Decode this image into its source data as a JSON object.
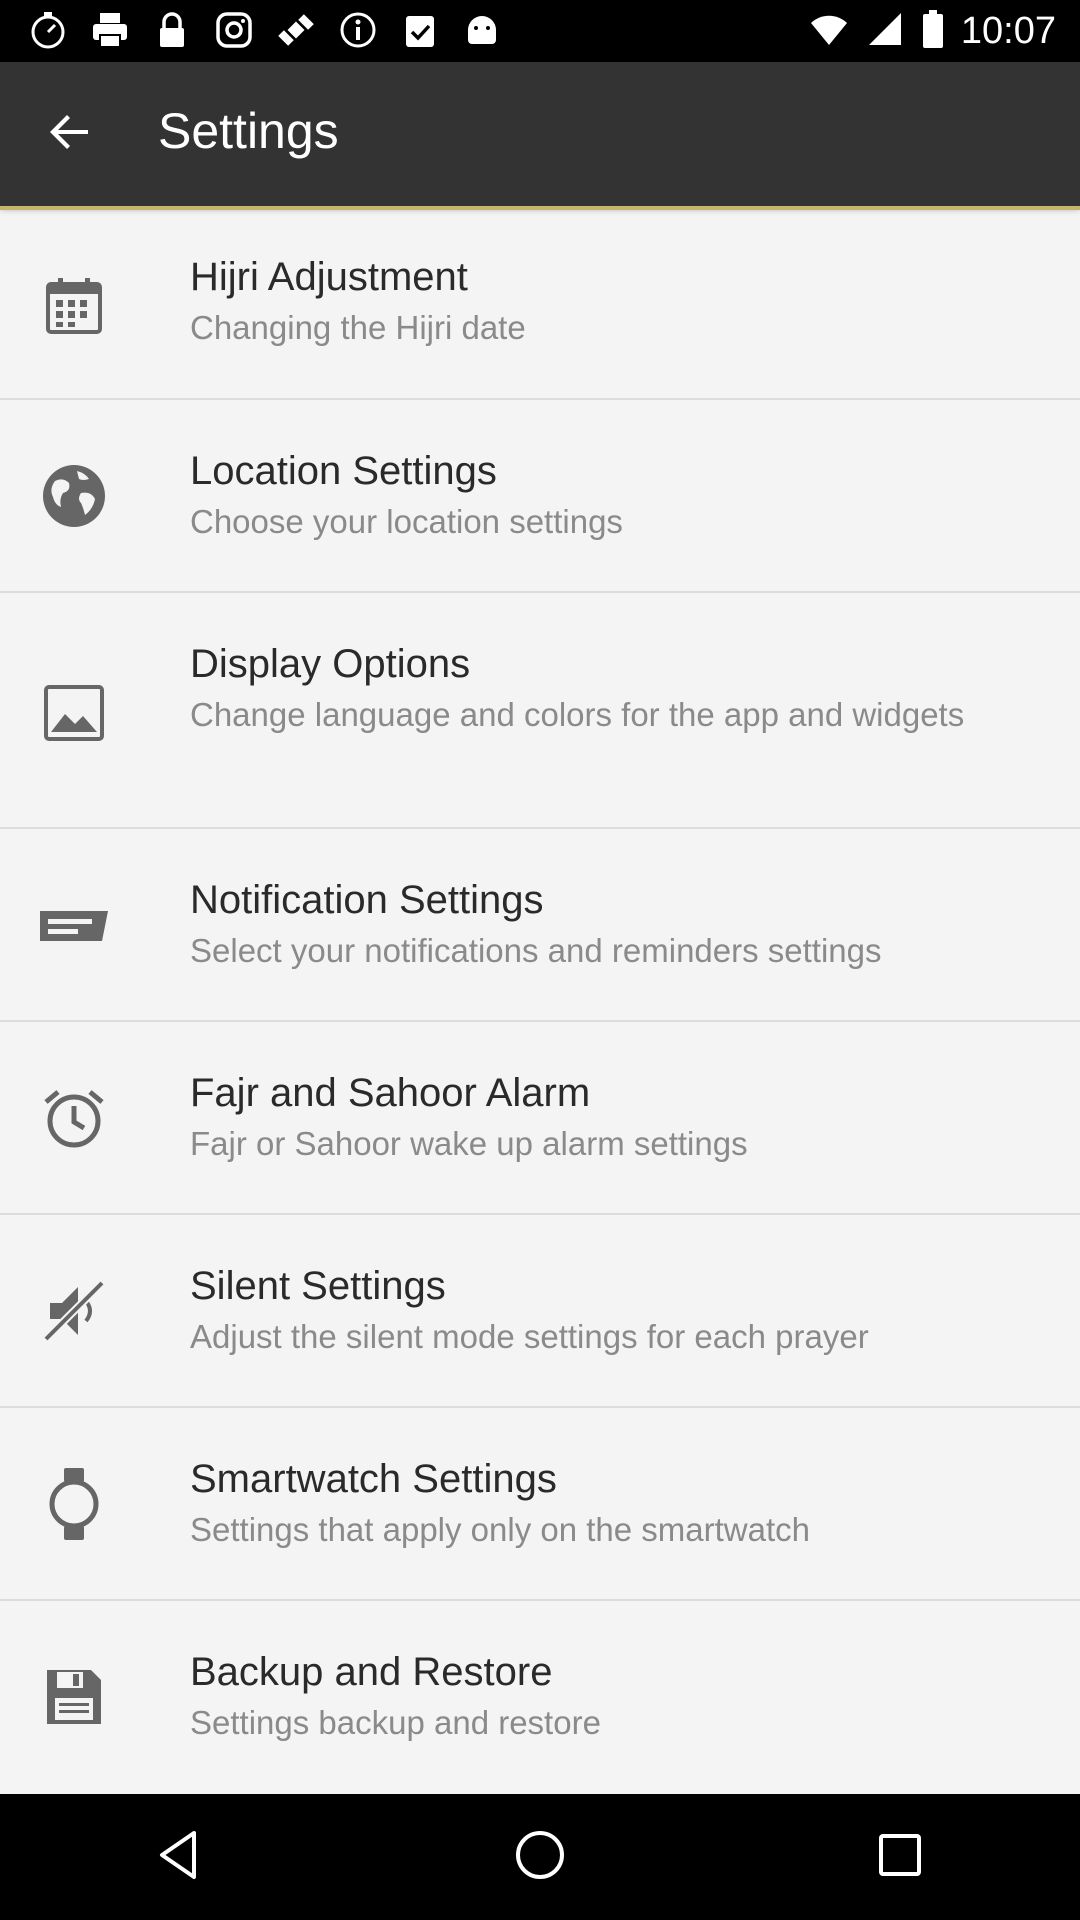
{
  "status_bar": {
    "time": "10:07",
    "left_icons": [
      "stopwatch-icon",
      "printer-icon",
      "lock-icon",
      "instagram-icon",
      "satellite-icon",
      "info-icon",
      "clipboard-check-icon",
      "android-icon"
    ],
    "right_icons": [
      "wifi-icon",
      "signal-icon",
      "battery-icon"
    ]
  },
  "app_bar": {
    "title": "Settings",
    "back_icon": "arrow-back-icon"
  },
  "settings": {
    "items": [
      {
        "title": "Hijri Adjustment",
        "subtitle": "Changing the Hijri date",
        "icon": "calendar-icon"
      },
      {
        "title": "Location Settings",
        "subtitle": "Choose your location settings",
        "icon": "globe-icon"
      },
      {
        "title": "Display Options",
        "subtitle": "Change language and colors for the app and widgets",
        "icon": "image-icon"
      },
      {
        "title": "Notification Settings",
        "subtitle": "Select your notifications and reminders settings",
        "icon": "notification-icon"
      },
      {
        "title": "Fajr and Sahoor Alarm",
        "subtitle": "Fajr or Sahoor wake up alarm settings",
        "icon": "alarm-clock-icon"
      },
      {
        "title": "Silent Settings",
        "subtitle": "Adjust the silent mode settings for each prayer",
        "icon": "mute-icon"
      },
      {
        "title": "Smartwatch Settings",
        "subtitle": "Settings that apply only on the smartwatch",
        "icon": "watch-icon"
      },
      {
        "title": "Backup and Restore",
        "subtitle": "Settings backup and restore",
        "icon": "save-icon"
      }
    ]
  },
  "nav_bar": {
    "buttons": [
      "back-triangle-icon",
      "home-circle-icon",
      "recents-square-icon"
    ]
  },
  "colors": {
    "app_bar": "#333333",
    "background": "#f4f4f4",
    "accent": "#c9b56a"
  }
}
